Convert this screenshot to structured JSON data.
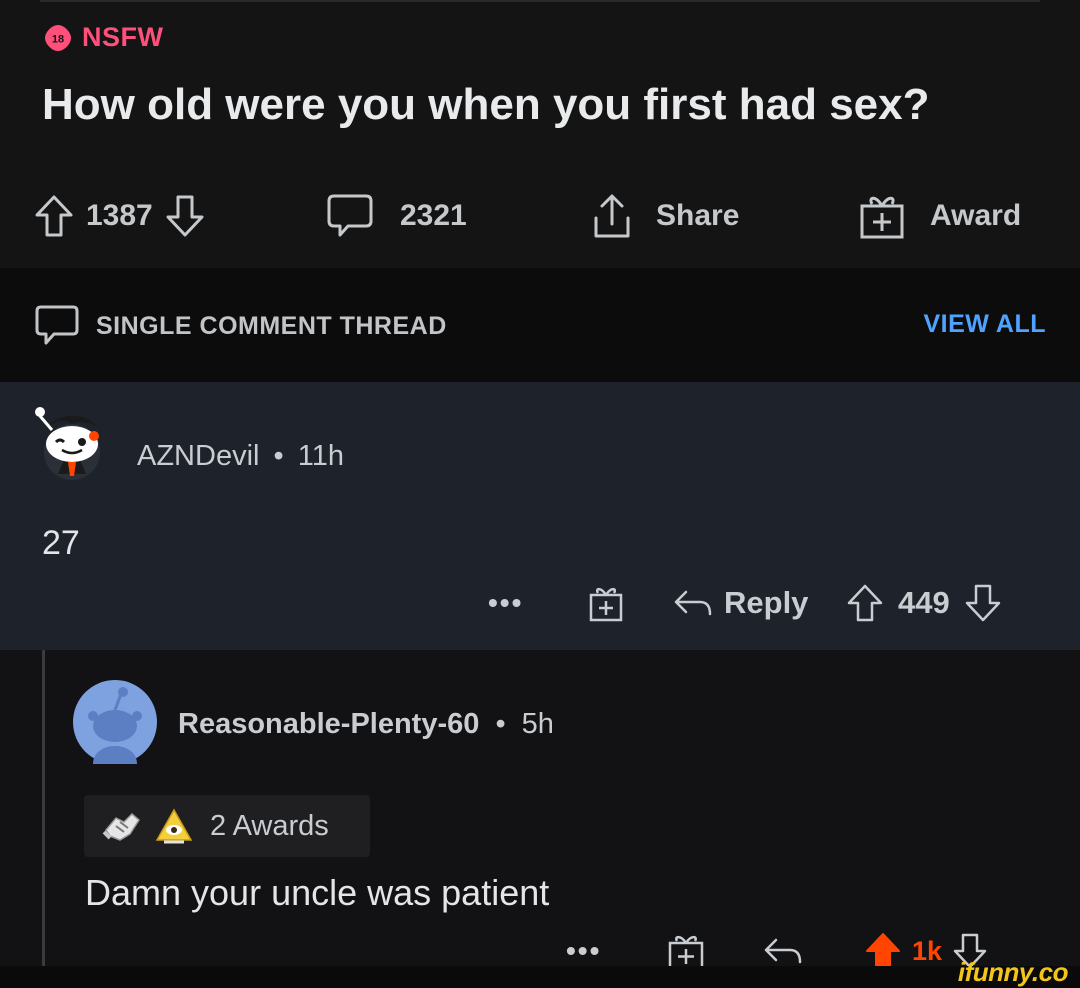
{
  "post": {
    "nsfw_label": "NSFW",
    "nsfw_badge": "18",
    "title": "How old were you when you first had sex?",
    "upvotes": "1387",
    "comments": "2321",
    "share_label": "Share",
    "award_label": "Award"
  },
  "thread": {
    "label": "SINGLE COMMENT THREAD",
    "view_all": "VIEW ALL"
  },
  "comment1": {
    "username": "AZNDevil",
    "separator": "•",
    "age": "11h",
    "body": "27",
    "more": "•••",
    "reply_label": "Reply",
    "score": "449"
  },
  "comment2": {
    "username": "Reasonable-Plenty-60",
    "separator": "•",
    "age": "5h",
    "awards_label": "2 Awards",
    "body": "Damn your uncle was patient",
    "more": "•••",
    "score": "1k"
  },
  "watermark": "ifunny.co",
  "colors": {
    "nsfw": "#ff4f7b",
    "link": "#4fa3ff",
    "upvote_active": "#ff4500",
    "comment_highlight": "#1d222b"
  }
}
